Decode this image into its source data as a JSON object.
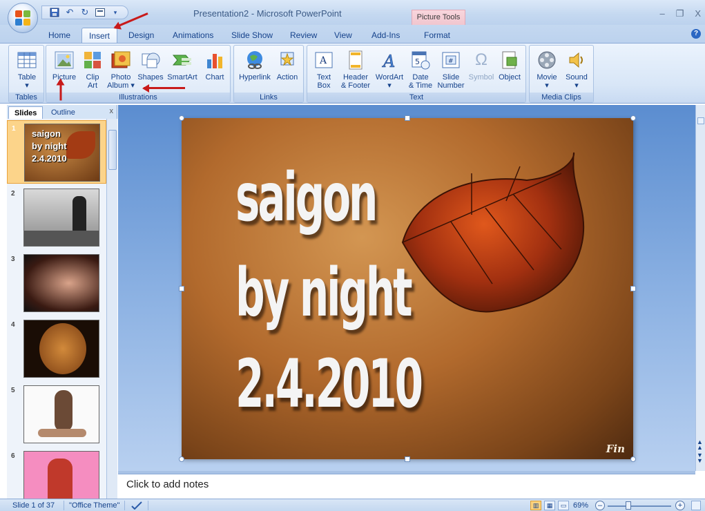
{
  "window": {
    "title": "Presentation2 - Microsoft PowerPoint",
    "contextual_tab_group": "Picture Tools",
    "minimize": "–",
    "restore": "❐",
    "close": "X"
  },
  "quick_access": {
    "save_icon": "floppy-icon",
    "undo": "↶",
    "redo": "↻"
  },
  "tabs": [
    {
      "label": "Home"
    },
    {
      "label": "Insert",
      "active": true
    },
    {
      "label": "Design"
    },
    {
      "label": "Animations"
    },
    {
      "label": "Slide Show"
    },
    {
      "label": "Review"
    },
    {
      "label": "View"
    },
    {
      "label": "Add-Ins"
    },
    {
      "label": "Format",
      "contextual": true
    }
  ],
  "ribbon": {
    "groups": {
      "tables": "Tables",
      "illustrations": "Illustrations",
      "links": "Links",
      "text": "Text",
      "media": "Media Clips"
    },
    "buttons": {
      "table": [
        "Table",
        "▾"
      ],
      "picture": [
        "Picture",
        ""
      ],
      "clipart": [
        "Clip",
        "Art"
      ],
      "photoalbum": [
        "Photo",
        "Album ▾"
      ],
      "shapes": [
        "Shapes",
        ""
      ],
      "smartart": [
        "SmartArt",
        ""
      ],
      "chart": [
        "Chart",
        ""
      ],
      "hyperlink": [
        "Hyperlink",
        ""
      ],
      "action": [
        "Action",
        ""
      ],
      "textbox": [
        "Text",
        "Box"
      ],
      "headerfooter": [
        "Header",
        "& Footer"
      ],
      "wordart": [
        "WordArt",
        "▾"
      ],
      "datetime": [
        "Date",
        "& Time"
      ],
      "slidenumber": [
        "Slide",
        "Number"
      ],
      "symbol": [
        "Symbol",
        ""
      ],
      "object": [
        "Object",
        ""
      ],
      "movie": [
        "Movie",
        "▾"
      ],
      "sound": [
        "Sound",
        "▾"
      ]
    }
  },
  "left_pane": {
    "tabs": [
      "Slides",
      "Outline"
    ],
    "close": "x",
    "thumbnails": [
      {
        "num": "1",
        "selected": true
      },
      {
        "num": "2"
      },
      {
        "num": "3"
      },
      {
        "num": "4"
      },
      {
        "num": "5"
      },
      {
        "num": "6"
      }
    ]
  },
  "slide": {
    "line1": "saigon",
    "line2": "by night",
    "line3": "2.4.2010",
    "corner_text": "Fin"
  },
  "thumb1_text": [
    "saigon",
    "by night",
    "2.4.2010"
  ],
  "notes": {
    "placeholder": "Click to add notes"
  },
  "status": {
    "slide_info": "Slide 1 of 37",
    "theme": "\"Office Theme\"",
    "zoom": "69%",
    "zoom_value": 0.69
  },
  "colors": {
    "accent_arrow": "#c81a1a",
    "ribbon": "#dce8f7",
    "selected_thumb": "#fcd48a"
  }
}
